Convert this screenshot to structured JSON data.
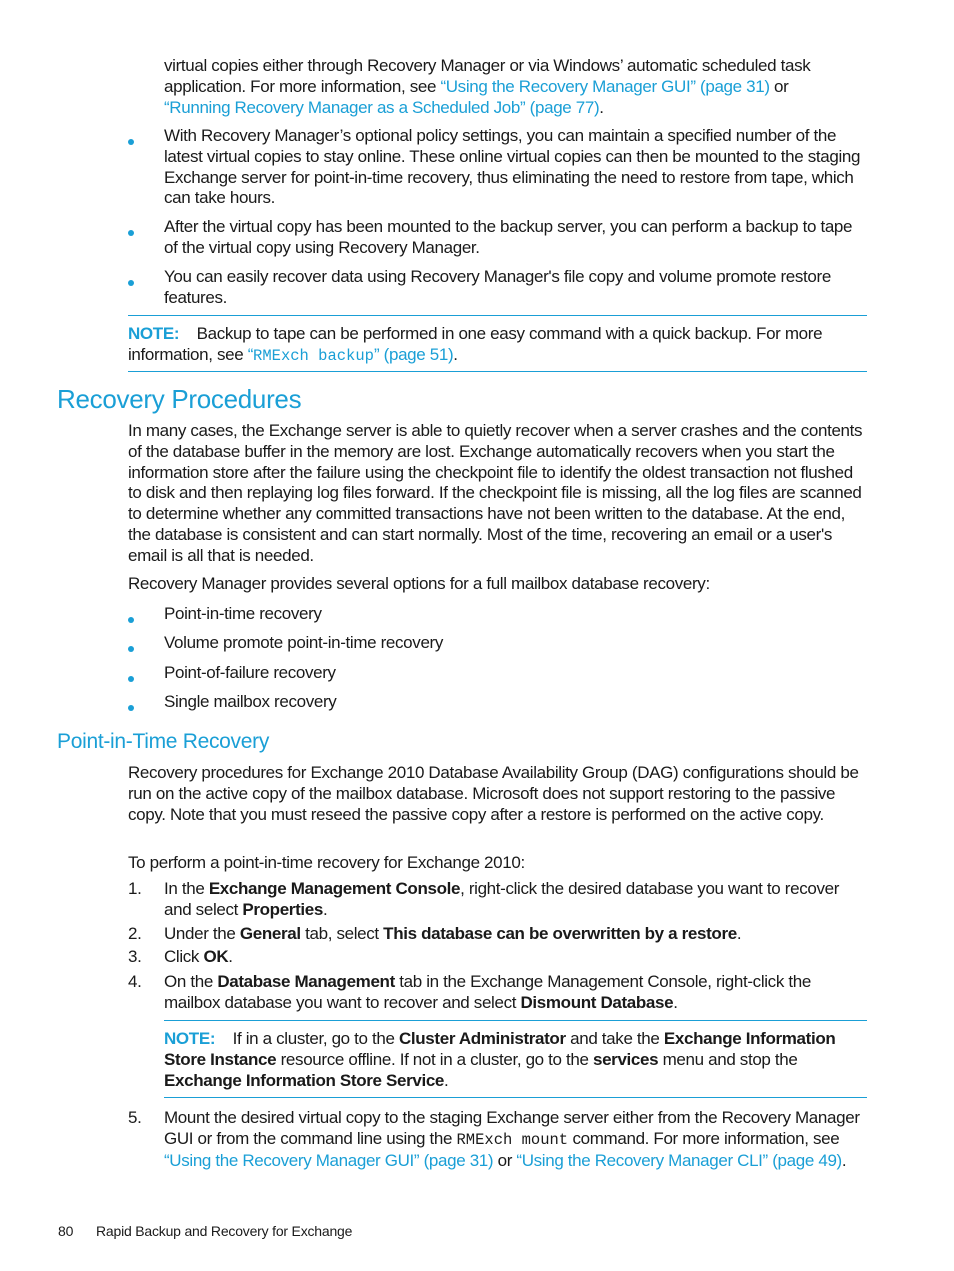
{
  "intro": {
    "line1": "virtual copies either through Recovery Manager or via Windows’ automatic scheduled task",
    "line2_pre": "application. For more information, see ",
    "link1": "“Using the Recovery Manager GUI” (page 31)",
    "line2_post": " or",
    "link2": "“Running Recovery Manager as a Scheduled Job” (page 77)",
    "line3_post": "."
  },
  "bullets_top": [
    "With Recovery Manager’s optional policy settings, you can maintain a specified number of the latest virtual copies to stay online. These online virtual copies can then be mounted to the staging Exchange server for point-in-time recovery, thus eliminating the need to restore from tape, which can take hours.",
    "After the virtual copy has been mounted to the backup server, you can perform a backup to tape of the virtual copy using Recovery Manager.",
    "You can easily recover data using Recovery Manager's file copy and volume promote restore features."
  ],
  "note1": {
    "label": "NOTE:",
    "text1": "Backup to tape can be performed in one easy command with a quick backup. For more",
    "text2_pre": "information, see ",
    "link_q1": "“",
    "link_code": "RMExch backup",
    "link_q2": "” (page 51)",
    "text2_post": "."
  },
  "section1": {
    "heading": "Recovery Procedures",
    "para": "In many cases, the Exchange server is able to quietly recover when a server crashes and the contents of the database buffer in the memory are lost. Exchange automatically recovers when you start the information store after the failure using the checkpoint file to identify the oldest transaction not flushed to disk and then replaying log files forward. If the checkpoint file is missing, all the log files are scanned to determine whether any committed transactions have not been written to the database. At the end, the database is consistent and can start normally. Most of the time, recovering an email or a user's email is all that is needed.",
    "options_intro": "Recovery Manager provides several options for a full mailbox database recovery:",
    "options": [
      "Point-in-time recovery",
      "Volume promote point-in-time recovery",
      "Point-of-failure recovery",
      "Single mailbox recovery"
    ]
  },
  "section2": {
    "heading": "Point-in-Time Recovery",
    "para": "Recovery procedures for Exchange 2010 Database Availability Group (DAG) configurations should be run on the active copy of the mailbox database. Microsoft does not support restoring to the passive copy. Note that you must reseed the passive copy after a restore is performed on the active copy.",
    "steps_intro": "To perform a point-in-time recovery for Exchange 2010:",
    "steps": [
      {
        "num": "1.",
        "a": "In the ",
        "b": "Exchange Management Console",
        "c": ", right-click the desired database you want to recover and select ",
        "d": "Properties",
        "e": "."
      },
      {
        "num": "2.",
        "a": "Under the ",
        "b": "General",
        "c": " tab, select ",
        "d": "This database can be overwritten by a restore",
        "e": "."
      },
      {
        "num": "3.",
        "a": "Click ",
        "b": "OK",
        "c": "."
      },
      {
        "num": "4.",
        "a": "On the ",
        "b": "Database Management",
        "c": " tab in the Exchange Management Console, right-click the mailbox database you want to recover and select ",
        "d": "Dismount Database",
        "e": "."
      },
      {
        "num": "5.",
        "a": "Mount the desired virtual copy to the staging Exchange server either from the Recovery Manager GUI or from the command line using the ",
        "code": "RMExch mount",
        "c": " command. For more information, see ",
        "link1": "“Using the Recovery Manager GUI” (page 31)",
        "or": " or ",
        "link2": "“Using the Recovery Manager CLI” (page 49)",
        "end": "."
      }
    ],
    "note2": {
      "label": "NOTE:",
      "a": "If in a cluster, go to the ",
      "b": "Cluster Administrator",
      "c": " and take the ",
      "d": "Exchange Information Store Instance",
      "e": " resource offline. If not in a cluster, go to the ",
      "f": "services",
      "g": " menu and stop the ",
      "h": "Exchange Information Store Service",
      "i": "."
    }
  },
  "footer": {
    "page_number": "80",
    "title": "Rapid Backup and Recovery for Exchange"
  },
  "colors": {
    "accent": "#1a9fd6",
    "text": "#1a1a1a"
  }
}
